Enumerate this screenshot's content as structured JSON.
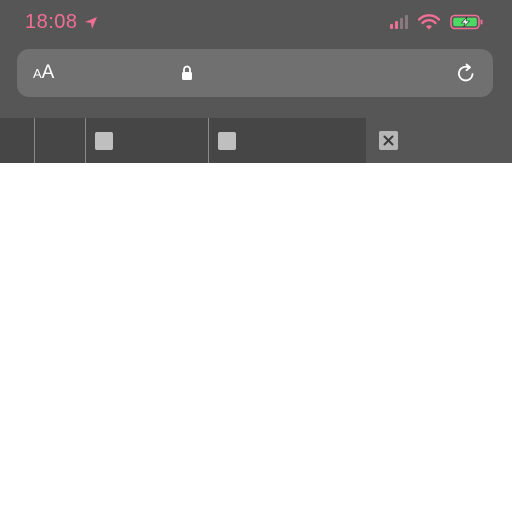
{
  "status_bar": {
    "time": "18:08",
    "location_icon": "location-arrow-icon",
    "signal_icon": "cellular-signal-icon",
    "wifi_icon": "wifi-icon",
    "battery_icon": "battery-charging-icon"
  },
  "address_bar": {
    "text_size_small": "A",
    "text_size_large": "A",
    "lock_icon": "lock-icon",
    "reload_icon": "reload-icon"
  },
  "tabs": {
    "close_icon": "close-icon"
  },
  "colors": {
    "status_accent": "#ef6f95",
    "battery_fill": "#4cd964",
    "chrome_bg": "#565656",
    "address_bg": "#707070",
    "tab_bg": "#464646"
  }
}
